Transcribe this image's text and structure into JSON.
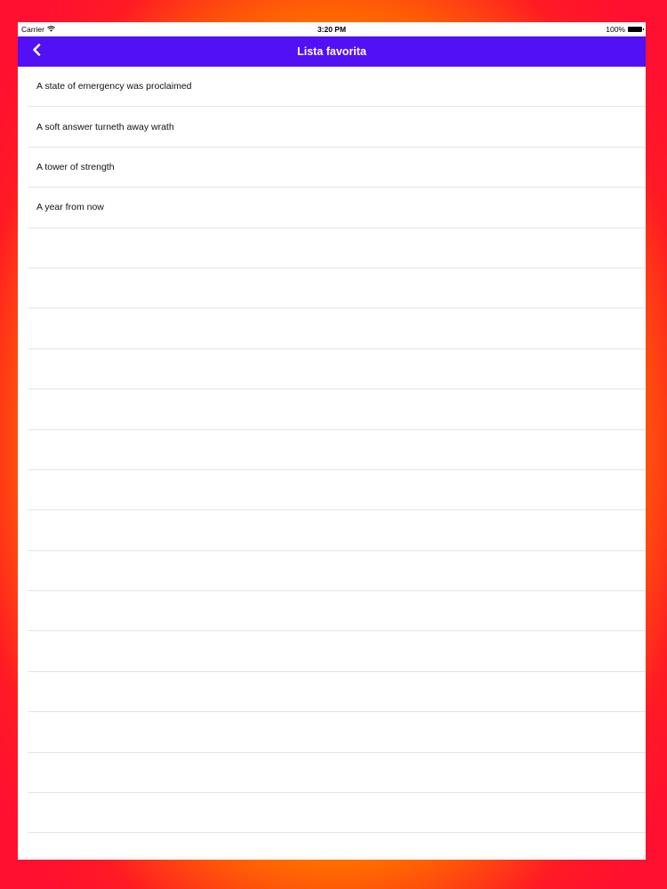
{
  "status_bar": {
    "carrier": "Carrier",
    "time": "3:20 PM",
    "battery": "100%"
  },
  "nav_bar": {
    "title": "Lista favorita",
    "background_color": "#5210f5"
  },
  "favorites": [
    {
      "label": "A state of emergency was proclaimed"
    },
    {
      "label": "A soft answer turneth away wrath"
    },
    {
      "label": "A tower of strength"
    },
    {
      "label": "A year from now"
    }
  ]
}
